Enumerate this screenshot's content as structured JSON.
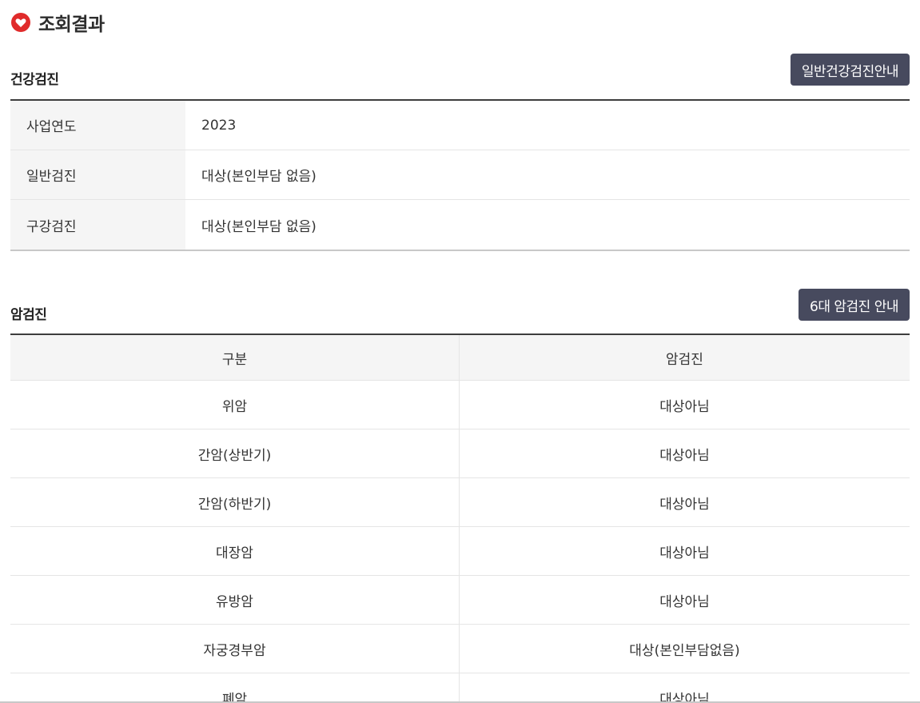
{
  "header": {
    "title": "조회결과",
    "icon": "heart-icon",
    "icon_color": "#e02b2b"
  },
  "health_check": {
    "section_title": "건강검진",
    "guide_button": "일반건강검진안내",
    "rows": [
      {
        "label": "사업연도",
        "value": "2023"
      },
      {
        "label": "일반검진",
        "value": "대상(본인부담 없음)"
      },
      {
        "label": "구강검진",
        "value": "대상(본인부담 없음)"
      }
    ]
  },
  "cancer_check": {
    "section_title": "암검진",
    "guide_button": "6대 암검진 안내",
    "columns": [
      "구분",
      "암검진"
    ],
    "rows": [
      {
        "type": "위암",
        "status": "대상아님"
      },
      {
        "type": "간암(상반기)",
        "status": "대상아님"
      },
      {
        "type": "간암(하반기)",
        "status": "대상아님"
      },
      {
        "type": "대장암",
        "status": "대상아님"
      },
      {
        "type": "유방암",
        "status": "대상아님"
      },
      {
        "type": "자궁경부암",
        "status": "대상(본인부담없음)"
      },
      {
        "type": "폐암",
        "status": "대상아님"
      }
    ]
  },
  "colors": {
    "button_bg": "#474a5e",
    "table_head_bg": "#f5f5f5"
  }
}
